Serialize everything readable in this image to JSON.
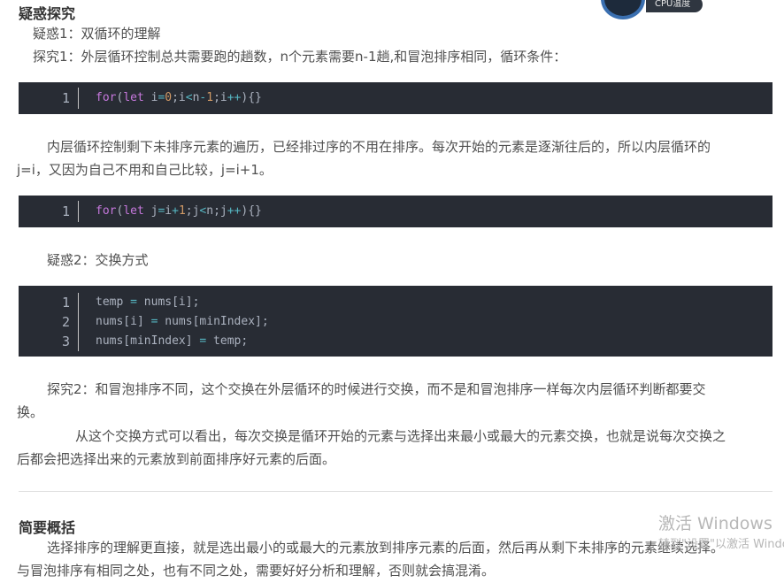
{
  "section1": {
    "heading": "疑惑探究",
    "q1": "疑惑1：双循环的理解",
    "a1": "探究1：外层循环控制总共需要跑的趟数，n个元素需要n-1趟,和冒泡排序相同，循环条件：",
    "inner_para_line1": "内层循环控制剩下未排序元素的遍历，已经排过序的不用在排序。每次开始的元素是逐渐往后的，所以内层循环的",
    "inner_para_line2": "j=i，又因为自己不用和自己比较，j=i+1。",
    "q2": "疑惑2：交换方式",
    "a2_line1": "探究2：和冒泡排序不同，这个交换在外层循环的时候进行交换，而不是和冒泡排序一样每次内层循环判断都要交",
    "a2_line2": "换。",
    "a2b_line1": "从这个交换方式可以看出，每次交换是循环开始的元素与选择出来最小或最大的元素交换，也就是说每次交换之",
    "a2b_line2": "后都会把选择出来的元素放到前面排序好元素的后面。"
  },
  "code1": {
    "line_numbers": [
      "1"
    ],
    "tokens": {
      "kw_for": "for",
      "p1": "(",
      "kw_let": "let",
      "v1": " i",
      "eq": "=",
      "n0": "0",
      "semi1": ";i",
      "lt": "<",
      "v2": "n",
      "minus": "-",
      "n1": "1",
      "semi2": ";i",
      "inc": "++",
      "end": "){}"
    }
  },
  "code2": {
    "line_numbers": [
      "1"
    ],
    "tokens": {
      "kw_for": "for",
      "p1": "(",
      "kw_let": "let",
      "v1": " j",
      "eq": "=",
      "v2": "i",
      "plus": "+",
      "n1": "1",
      "semi1": ";j",
      "lt": "<",
      "v3": "n",
      "semi2": ";j",
      "inc": "++",
      "end": "){}"
    }
  },
  "code3": {
    "line_numbers": [
      "1",
      "2",
      "3"
    ],
    "line1": {
      "a": "temp ",
      "eq": "=",
      "b": " nums[i];"
    },
    "line2": {
      "a": "nums[i] ",
      "eq": "=",
      "b": " nums[minIndex];"
    },
    "line3": {
      "a": "nums[minIndex] ",
      "eq": "=",
      "b": " temp;"
    }
  },
  "section2": {
    "heading": "简要概括",
    "line1": "选择排序的理解更直接，就是选出最小的或最大的元素放到排序元素的后面，然后再从剩下未排序的元素继续选择。",
    "line2": "与冒泡排序有相同之处，也有不同之处，需要好好分析和理解，否则就会搞混淆。"
  },
  "widget": {
    "label": "CPU温度"
  },
  "watermark": {
    "title": "激活 Windows",
    "subtitle": "转到\"设置\"以激活 Windows。"
  },
  "colors": {
    "code_bg": "#282c34",
    "keyword": "#c678dd",
    "number": "#d19a66",
    "operator": "#56b6c2",
    "text": "#4f4f4f"
  }
}
